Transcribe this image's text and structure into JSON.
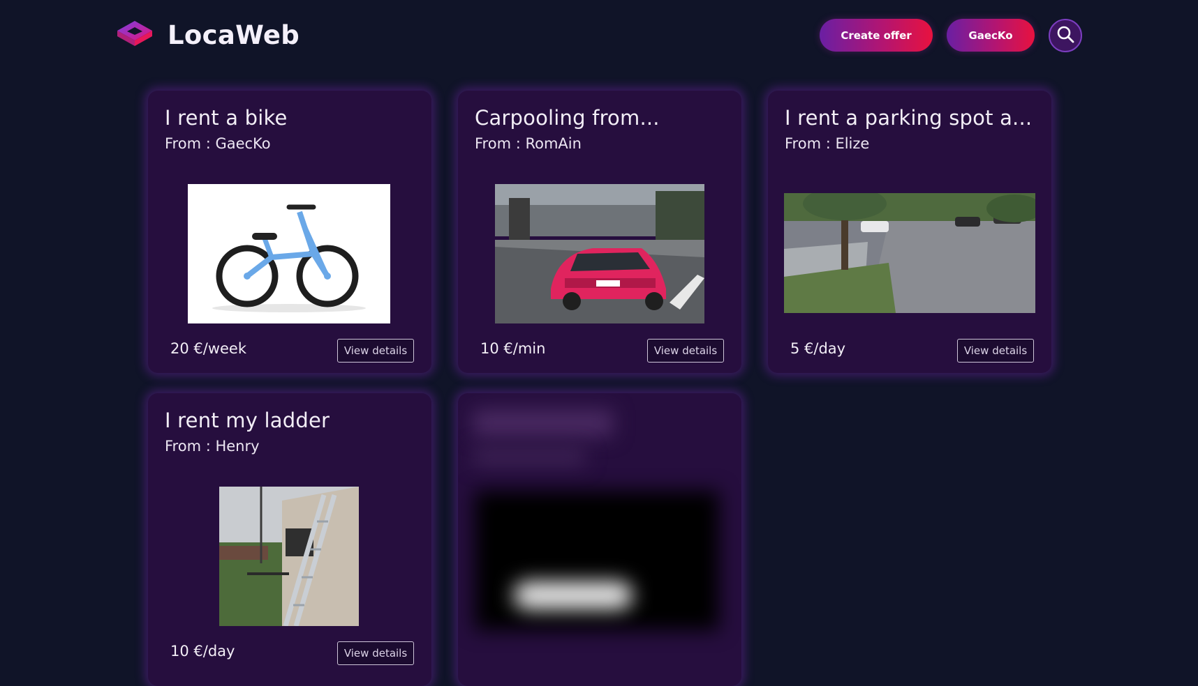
{
  "header": {
    "brand": "LocaWeb",
    "create_offer_label": "Create offer",
    "user_label": "GaecKo",
    "search_icon": "search-icon",
    "logo_icon": "diamond-logo-icon"
  },
  "colors": {
    "background": "#101428",
    "card": "#260e3e",
    "card_glow": "#8228be",
    "accent_purple": "#6a1fa3",
    "accent_red": "#e8123f"
  },
  "offers": [
    {
      "title": "I rent a bike",
      "from": "From : GaecKo",
      "price": "20 €/week",
      "details_label": "View details",
      "image": "balance-bike-photo"
    },
    {
      "title": "Carpooling from...",
      "from": "From : RomAin",
      "price": "10 €/min",
      "details_label": "View details",
      "image": "red-car-photo"
    },
    {
      "title": "I rent a parking spot a...",
      "from": "From : Elize",
      "price": "5 €/day",
      "details_label": "View details",
      "image": "parking-lot-photo"
    },
    {
      "title": "I rent my ladder",
      "from": "From : Henry",
      "price": "10 €/day",
      "details_label": "View details",
      "image": "ladder-photo"
    }
  ]
}
